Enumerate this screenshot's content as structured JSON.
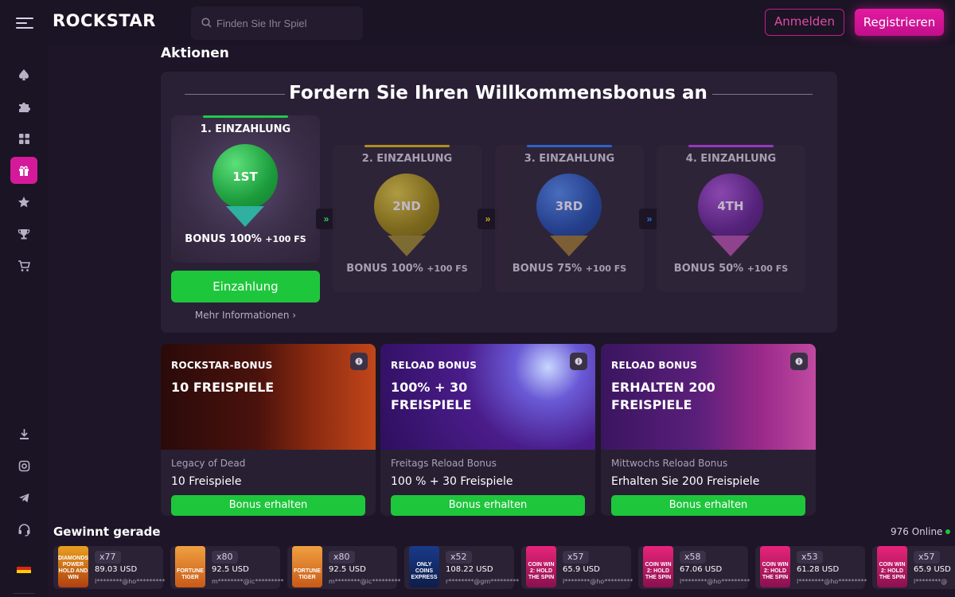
{
  "header": {
    "logo": "ROCKSTAR",
    "search_placeholder": "Finden Sie Ihr Spiel",
    "login_label": "Anmelden",
    "register_label": "Registrieren"
  },
  "sidebar": {
    "items": [
      {
        "icon": "spade-icon"
      },
      {
        "icon": "puzzle-icon"
      },
      {
        "icon": "grid-icon"
      },
      {
        "icon": "gift-icon",
        "active": true
      },
      {
        "icon": "star-icon"
      },
      {
        "icon": "trophy-icon"
      },
      {
        "icon": "cart-icon"
      }
    ],
    "bottom_items": [
      {
        "icon": "download-icon"
      },
      {
        "icon": "instagram-icon"
      },
      {
        "icon": "telegram-icon"
      },
      {
        "icon": "headset-icon"
      },
      {
        "icon": "flag-de-icon"
      }
    ]
  },
  "page": {
    "title": "Aktionen"
  },
  "welcome": {
    "heading": "Fordern Sie Ihren Willkommensbonus an",
    "deposits": [
      {
        "title": "1. EINZAHLUNG",
        "medal": "1ST",
        "bonus": "BONUS 100%",
        "fs": "+100 FS",
        "color": "#22b24a"
      },
      {
        "title": "2. EINZAHLUNG",
        "medal": "2ND",
        "bonus": "BONUS 100%",
        "fs": "+100 FS",
        "color": "#c9a21c"
      },
      {
        "title": "3. EINZAHLUNG",
        "medal": "3RD",
        "bonus": "BONUS 75%",
        "fs": "+100 FS",
        "color": "#2f6fe0"
      },
      {
        "title": "4. EINZAHLUNG",
        "medal": "4TH",
        "bonus": "BONUS 50%",
        "fs": "+100 FS",
        "color": "#a63fd6"
      }
    ],
    "deposit_button": "Einzahlung",
    "more_info": "Mehr Informationen"
  },
  "promos": [
    {
      "label": "ROCKSTAR-BONUS",
      "title": "10 FREISPIELE",
      "subtitle": "Legacy of Dead",
      "name": "10 Freispiele",
      "button": "Bonus erhalten"
    },
    {
      "label": "RELOAD BONUS",
      "title": "100% + 30 FREISPIELE",
      "subtitle": "Freitags Reload Bonus",
      "name": "100 % + 30 Freispiele",
      "button": "Bonus erhalten"
    },
    {
      "label": "RELOAD BONUS",
      "title": "ERHALTEN 200 FREISPIELE",
      "subtitle": "Mittwochs Reload Bonus",
      "name": "Erhalten Sie 200 Freispiele",
      "button": "Bonus erhalten"
    }
  ],
  "wins": {
    "title": "Gewinnt gerade",
    "online_count": "976",
    "online_label": "Online",
    "items": [
      {
        "game": "DIAMONDS POWER HOLD AND WIN",
        "mult": "x77",
        "amount": "89.03 USD",
        "user": "l********@ho*********"
      },
      {
        "game": "FORTUNE TIGER",
        "mult": "x80",
        "amount": "92.5 USD",
        "user": "m********@ic*********"
      },
      {
        "game": "FORTUNE TIGER",
        "mult": "x80",
        "amount": "92.5 USD",
        "user": "m********@ic*********"
      },
      {
        "game": "ONLY COINS EXPRESS",
        "mult": "x52",
        "amount": "108.22 USD",
        "user": "r********@gm*********"
      },
      {
        "game": "COIN WIN 2: HOLD THE SPIN",
        "mult": "x57",
        "amount": "65.9 USD",
        "user": "l********@ho*********"
      },
      {
        "game": "COIN WIN 2: HOLD THE SPIN",
        "mult": "x58",
        "amount": "67.06 USD",
        "user": "l********@ho*********"
      },
      {
        "game": "COIN WIN 2: HOLD THE SPIN",
        "mult": "x53",
        "amount": "61.28 USD",
        "user": "l********@ho*********"
      },
      {
        "game": "COIN WIN 2: HOLD THE SPIN",
        "mult": "x57",
        "amount": "65.9 USD",
        "user": "l********@"
      }
    ]
  }
}
